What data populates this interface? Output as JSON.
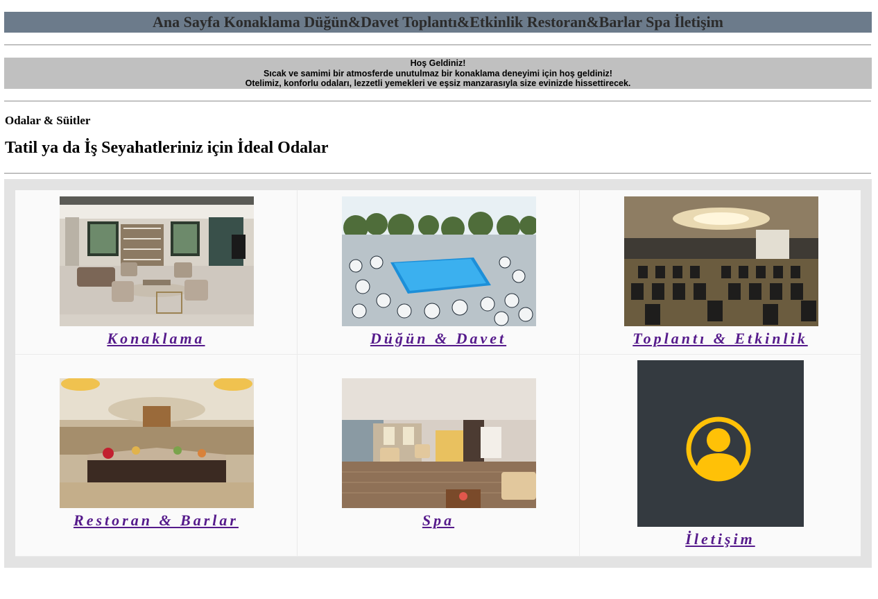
{
  "nav": {
    "items": [
      "Ana Sayfa",
      "Konaklama",
      "Düğün&Davet",
      "Toplantı&Etkinlik",
      "Restoran&Barlar",
      "Spa",
      "İletişim"
    ]
  },
  "welcome": {
    "title": "Hoş Geldiniz!",
    "line1": "Sıcak ve samimi bir atmosferde unutulmaz bir konaklama deneyimi için hoş geldiniz!",
    "line2": "Otelimiz, konforlu odaları, lezzetli yemekleri ve eşsiz manzarasıyla size evinizde hissettirecek."
  },
  "section": {
    "subtitle": "Odalar & Süitler",
    "title": "Tatil ya da İş Seyahatleriniz için İdeal Odalar"
  },
  "cards": [
    {
      "label": "Konaklama",
      "image": "lobby-lounge-photo"
    },
    {
      "label": "Düğün & Davet",
      "image": "poolside-banquet-photo"
    },
    {
      "label": "Toplantı & Etkinlik",
      "image": "conference-hall-photo"
    },
    {
      "label": "Restoran & Barlar",
      "image": "restaurant-buffet-photo"
    },
    {
      "label": "Spa",
      "image": "spa-reception-photo"
    },
    {
      "label": "İletişim",
      "image": "user-avatar-icon"
    }
  ],
  "colors": {
    "navbar": "#6c7b8b",
    "welcome_bg": "#c0c0c0",
    "link": "#551a8b",
    "avatar_bg": "#343a40",
    "avatar_fg": "#ffc107"
  }
}
